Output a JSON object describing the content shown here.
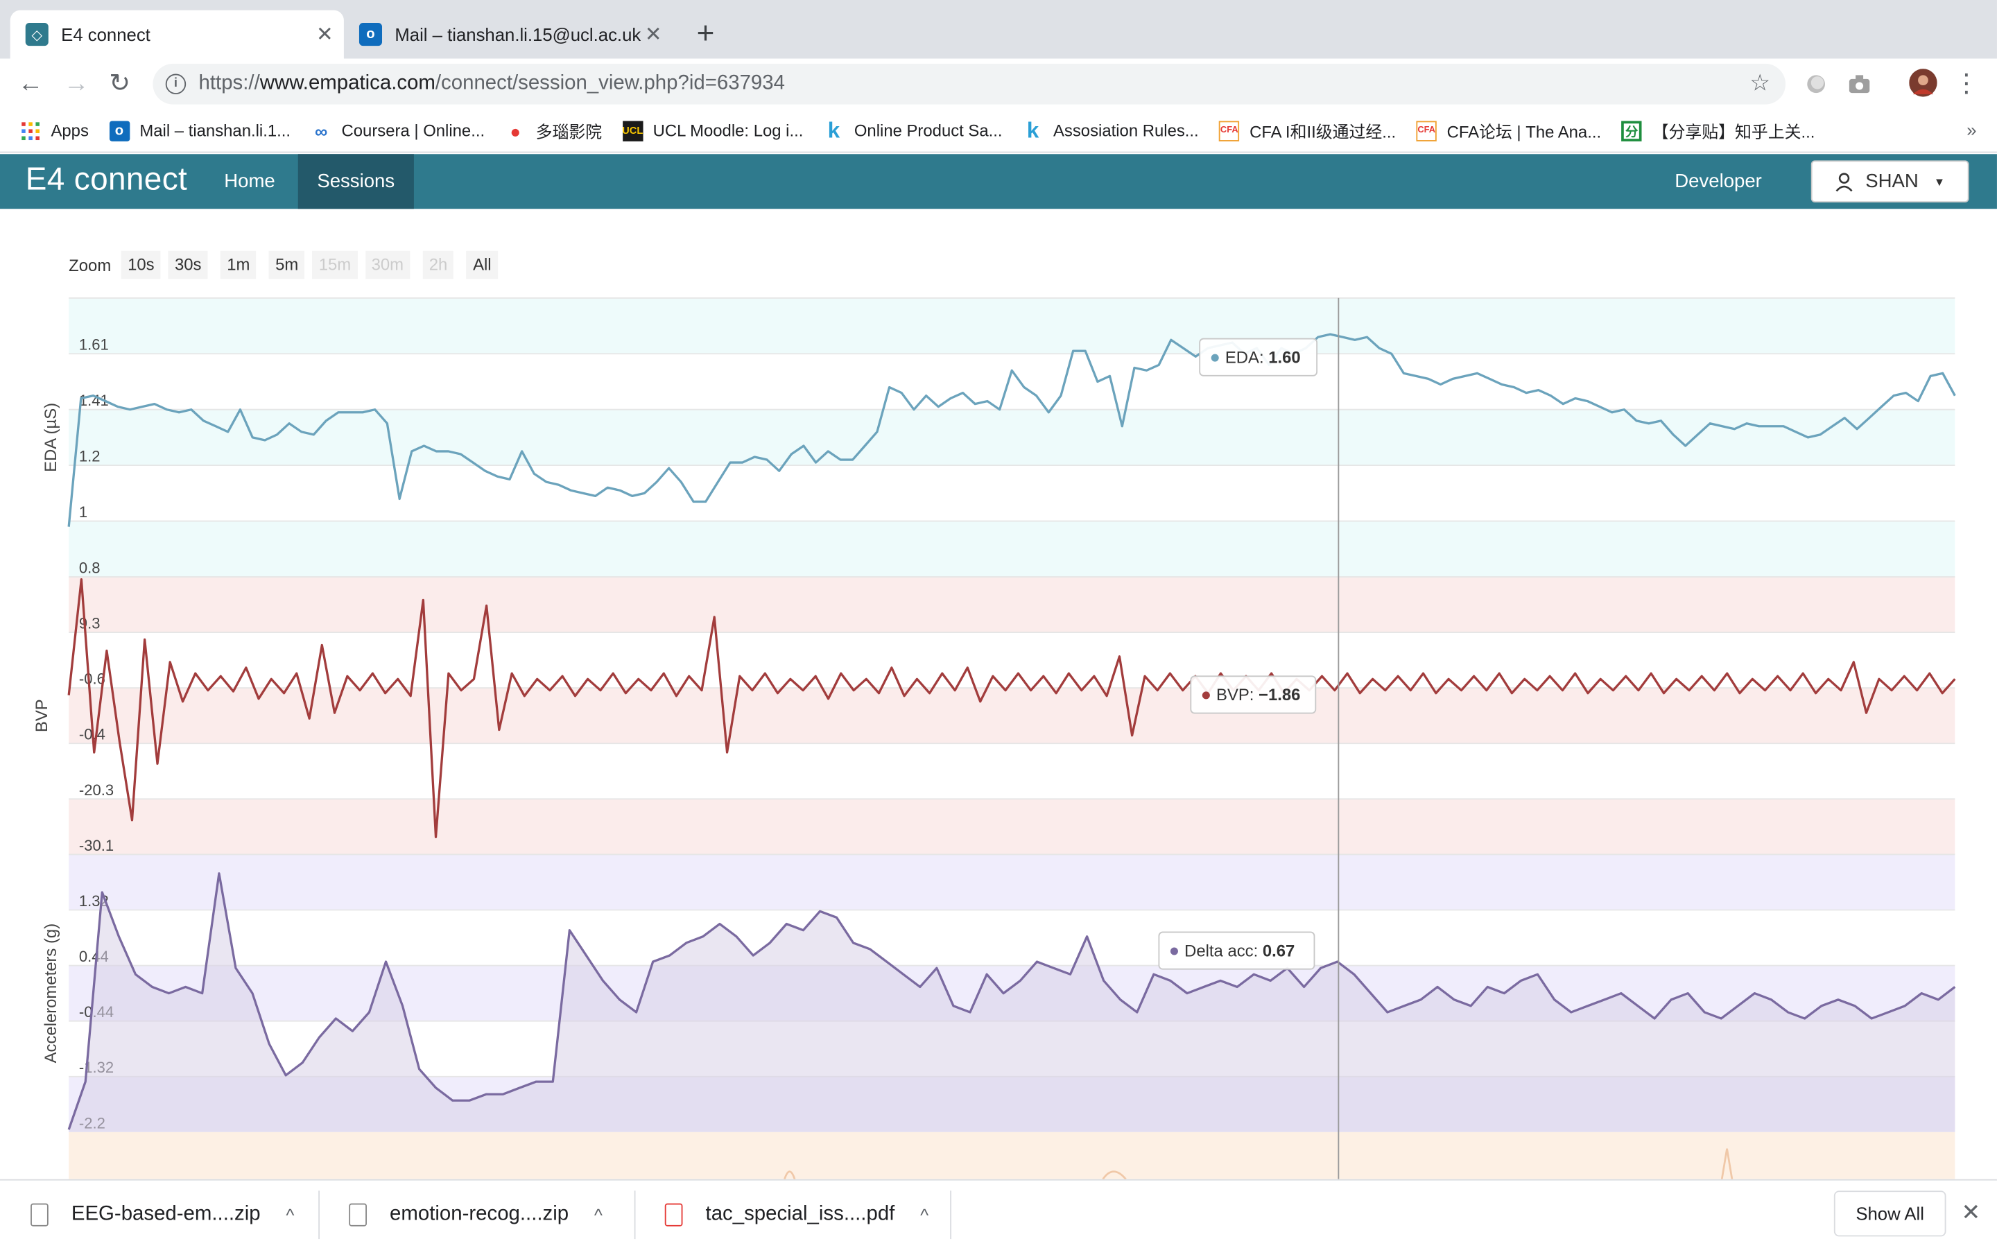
{
  "browser": {
    "tabs": [
      {
        "title": "E4 connect",
        "active": true
      },
      {
        "title": "Mail – tianshan.li.15@ucl.ac.uk",
        "active": false
      }
    ],
    "url": {
      "scheme": "https://",
      "host": "www.empatica.com",
      "path": "/connect/session_view.php?id=637934"
    },
    "bookmarks": [
      {
        "label": "Apps",
        "icon": "apps-grid-icon"
      },
      {
        "label": "Mail – tianshan.li.1...",
        "icon": "outlook-icon"
      },
      {
        "label": "Coursera | Online...",
        "icon": "coursera-icon"
      },
      {
        "label": "多瑙影院",
        "icon": "duonao-icon"
      },
      {
        "label": "UCL Moodle: Log i...",
        "icon": "ucl-icon"
      },
      {
        "label": "Online Product Sa...",
        "icon": "k-icon"
      },
      {
        "label": "Assosiation Rules...",
        "icon": "k-icon"
      },
      {
        "label": "CFA I和II级通过经...",
        "icon": "cfa-icon"
      },
      {
        "label": "CFA论坛 | The Ana...",
        "icon": "cfa-icon"
      },
      {
        "label": "【分享贴】知乎上关...",
        "icon": "share-icon"
      }
    ]
  },
  "app": {
    "brand": "E4 connect",
    "nav": [
      {
        "label": "Home",
        "active": false
      },
      {
        "label": "Sessions",
        "active": true
      }
    ],
    "developer": "Developer",
    "user": "SHAN"
  },
  "zoom": {
    "label": "Zoom",
    "options": [
      {
        "label": "10s",
        "enabled": true
      },
      {
        "label": "30s",
        "enabled": true
      },
      {
        "label": "1m",
        "enabled": true
      },
      {
        "label": "5m",
        "enabled": true
      },
      {
        "label": "15m",
        "enabled": false
      },
      {
        "label": "30m",
        "enabled": false
      },
      {
        "label": "2h",
        "enabled": false
      },
      {
        "label": "All",
        "enabled": true
      }
    ]
  },
  "chart_data": [
    {
      "type": "line",
      "ylabel": "EDA (µS)",
      "color": "#6ba3bc",
      "band_color": "#eefbfb",
      "ticks": [
        "1.61",
        "1.41",
        "1.2",
        "1",
        "0.8"
      ],
      "tick_values": [
        1.61,
        1.41,
        1.2,
        1.0,
        0.8
      ],
      "ylim": [
        0.8,
        1.8
      ],
      "tooltip": {
        "label": "EDA:",
        "value": "1.60"
      },
      "values": [
        0.98,
        1.44,
        1.45,
        1.43,
        1.41,
        1.4,
        1.41,
        1.42,
        1.4,
        1.39,
        1.4,
        1.36,
        1.34,
        1.32,
        1.4,
        1.3,
        1.29,
        1.31,
        1.35,
        1.32,
        1.31,
        1.36,
        1.39,
        1.39,
        1.39,
        1.4,
        1.35,
        1.08,
        1.25,
        1.27,
        1.25,
        1.25,
        1.24,
        1.21,
        1.18,
        1.16,
        1.15,
        1.25,
        1.17,
        1.14,
        1.13,
        1.11,
        1.1,
        1.09,
        1.12,
        1.11,
        1.09,
        1.1,
        1.14,
        1.19,
        1.14,
        1.07,
        1.07,
        1.14,
        1.21,
        1.21,
        1.23,
        1.22,
        1.18,
        1.24,
        1.27,
        1.21,
        1.25,
        1.22,
        1.22,
        1.27,
        1.32,
        1.48,
        1.46,
        1.4,
        1.45,
        1.41,
        1.44,
        1.46,
        1.42,
        1.43,
        1.4,
        1.54,
        1.48,
        1.45,
        1.39,
        1.45,
        1.61,
        1.61,
        1.5,
        1.52,
        1.34,
        1.55,
        1.54,
        1.56,
        1.65,
        1.62,
        1.59,
        1.62,
        1.63,
        1.64,
        1.6,
        1.62,
        1.56,
        1.62,
        1.6,
        1.62,
        1.66,
        1.67,
        1.66,
        1.65,
        1.66,
        1.62,
        1.6,
        1.53,
        1.52,
        1.51,
        1.49,
        1.51,
        1.52,
        1.53,
        1.51,
        1.49,
        1.48,
        1.46,
        1.47,
        1.45,
        1.42,
        1.44,
        1.43,
        1.41,
        1.39,
        1.4,
        1.36,
        1.35,
        1.36,
        1.31,
        1.27,
        1.31,
        1.35,
        1.34,
        1.33,
        1.35,
        1.34,
        1.34,
        1.34,
        1.32,
        1.3,
        1.31,
        1.34,
        1.37,
        1.33,
        1.37,
        1.41,
        1.45,
        1.46,
        1.43,
        1.52,
        1.53,
        1.45
      ]
    },
    {
      "type": "line",
      "ylabel": "BVP",
      "color": "#a23c3c",
      "band_color": "#fbeceb",
      "ticks": [
        "9.3",
        "-0.6",
        "-0.4",
        "-20.3",
        "-30.1"
      ],
      "tick_values": [
        9.3,
        -0.6,
        -0.4,
        -20.3,
        -30.1
      ],
      "ylim": [
        -30.1,
        19.1
      ],
      "tooltip": {
        "label": "BVP:",
        "value": "−1.86"
      },
      "values": [
        -1.86,
        19.0,
        -12.0,
        6.0,
        -10.0,
        -24.0,
        8.0,
        -14.0,
        4.0,
        -3.0,
        2.0,
        -1.0,
        1.5,
        -1.2,
        3.0,
        -2.5,
        1.0,
        -1.5,
        2.0,
        -6.0,
        7.0,
        -5.0,
        1.5,
        -1.0,
        2.0,
        -1.5,
        1.0,
        -2.0,
        15.0,
        -27.0,
        2.0,
        -1.0,
        1.0,
        14.0,
        -8.0,
        2.0,
        -2.0,
        1.0,
        -1.0,
        1.5,
        -2.0,
        1.0,
        -1.0,
        2.0,
        -1.5,
        1.0,
        -1.0,
        2.0,
        -2.0,
        1.5,
        -1.0,
        12.0,
        -12.0,
        1.5,
        -1.0,
        2.0,
        -1.5,
        1.0,
        -1.0,
        1.5,
        -2.5,
        2.0,
        -1.0,
        1.0,
        -1.5,
        3.0,
        -2.0,
        1.0,
        -1.5,
        2.0,
        -1.0,
        3.0,
        -3.0,
        1.5,
        -1.0,
        2.0,
        -1.0,
        1.5,
        -1.5,
        2.0,
        -1.0,
        1.5,
        -2.0,
        5.0,
        -9.0,
        1.5,
        -1.0,
        2.0,
        -1.0,
        1.5,
        -1.5,
        2.0,
        -1.0,
        1.5,
        -1.0,
        2.0,
        -1.5,
        1.0,
        -1.0,
        1.5,
        -1.0,
        2.0,
        -1.5,
        1.0,
        -1.0,
        1.5,
        -1.0,
        2.0,
        -1.5,
        1.0,
        -1.0,
        1.5,
        -1.0,
        2.0,
        -1.5,
        1.0,
        -1.0,
        1.5,
        -1.0,
        2.0,
        -1.5,
        1.0,
        -1.0,
        1.5,
        -1.0,
        2.0,
        -1.5,
        1.0,
        -1.0,
        1.5,
        -1.0,
        2.0,
        -1.5,
        1.0,
        -1.0,
        1.5,
        -1.0,
        2.0,
        -1.5,
        1.0,
        -1.0,
        4.0,
        -5.0,
        1.0,
        -1.0,
        1.5,
        -1.0,
        2.0,
        -1.5,
        1.0
      ]
    },
    {
      "type": "area",
      "ylabel": "Accelerometers (g)",
      "color": "#7a6aa0",
      "fill": "#d8d2e8",
      "band_color": "#f0edfc",
      "ticks": [
        "1.32",
        "0.44",
        "-0.44",
        "-1.32",
        "-2.2"
      ],
      "tick_values": [
        1.32,
        0.44,
        -0.44,
        -1.32,
        -2.2
      ],
      "ylim": [
        -2.2,
        2.2
      ],
      "tooltip": {
        "label": "Delta acc:",
        "value": "0.67"
      },
      "values": [
        -2.2,
        -1.4,
        1.6,
        0.9,
        0.3,
        0.1,
        0.0,
        0.1,
        0.0,
        1.9,
        0.4,
        0.0,
        -0.8,
        -1.3,
        -1.1,
        -0.7,
        -0.4,
        -0.6,
        -0.3,
        0.5,
        -0.2,
        -1.2,
        -1.5,
        -1.7,
        -1.7,
        -1.6,
        -1.6,
        -1.5,
        -1.4,
        -1.4,
        1.0,
        0.6,
        0.2,
        -0.1,
        -0.3,
        0.5,
        0.6,
        0.8,
        0.9,
        1.1,
        0.9,
        0.6,
        0.8,
        1.1,
        1.0,
        1.3,
        1.2,
        0.8,
        0.7,
        0.5,
        0.3,
        0.1,
        0.4,
        -0.2,
        -0.3,
        0.3,
        0.0,
        0.2,
        0.5,
        0.4,
        0.3,
        0.9,
        0.2,
        -0.1,
        -0.3,
        0.3,
        0.2,
        0.0,
        0.1,
        0.2,
        0.1,
        0.3,
        0.2,
        0.4,
        0.1,
        0.4,
        0.5,
        0.3,
        0.0,
        -0.3,
        -0.2,
        -0.1,
        0.1,
        -0.1,
        -0.2,
        0.1,
        0.0,
        0.2,
        0.3,
        -0.1,
        -0.3,
        -0.2,
        -0.1,
        0.0,
        -0.2,
        -0.4,
        -0.1,
        0.0,
        -0.3,
        -0.4,
        -0.2,
        0.0,
        -0.1,
        -0.3,
        -0.4,
        -0.2,
        -0.1,
        -0.2,
        -0.4,
        -0.3,
        -0.2,
        0.0,
        -0.1,
        0.1
      ]
    }
  ],
  "downloads": [
    {
      "name": "EEG-based-em....zip",
      "icon": "zip-file-icon"
    },
    {
      "name": "emotion-recog....zip",
      "icon": "zip-file-icon"
    },
    {
      "name": "tac_special_iss....pdf",
      "icon": "pdf-file-icon"
    }
  ],
  "shelf": {
    "show_all": "Show All"
  }
}
